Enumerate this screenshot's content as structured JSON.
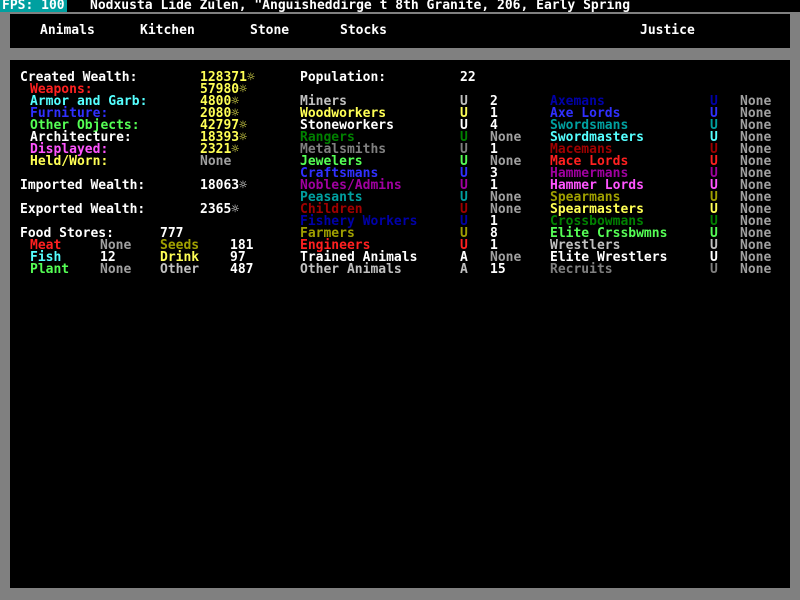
{
  "topbar": {
    "fps": "FPS: 100",
    "title": "Nodxusta Lide Zulen, \"Anguisheddirge t 8th Granite, 206, Early Spring"
  },
  "tabs": [
    "Animals",
    "Kitchen",
    "Stone",
    "Stocks",
    "Justice"
  ],
  "wealth": {
    "created": {
      "label": "Created Wealth:",
      "value": "128371☼"
    },
    "items": [
      {
        "label": "Weapons:",
        "value": "57980☼",
        "color": "#ff2020"
      },
      {
        "label": "Armor and Garb:",
        "value": "4800☼",
        "color": "#55ffff"
      },
      {
        "label": "Furniture:",
        "value": "2080☼",
        "color": "#3030ff"
      },
      {
        "label": "Other Objects:",
        "value": "42797☼",
        "color": "#55ff55"
      },
      {
        "label": "Architecture:",
        "value": "18393☼",
        "color": "#ffffff"
      },
      {
        "label": "Displayed:",
        "value": "2321☼",
        "color": "#ff55ff"
      },
      {
        "label": "Held/Worn:",
        "value": "None",
        "color": "#ffff55"
      }
    ],
    "imported": {
      "label": "Imported Wealth:",
      "value": "18063☼"
    },
    "exported": {
      "label": "Exported Wealth:",
      "value": "2365☼"
    }
  },
  "food": {
    "label": "Food Stores:",
    "value": "777",
    "meat": {
      "label": "Meat",
      "value": "None"
    },
    "seeds": {
      "label": "Seeds",
      "value": "181"
    },
    "fish": {
      "label": "Fish",
      "value": "12"
    },
    "drink": {
      "label": "Drink",
      "value": "97"
    },
    "plant": {
      "label": "Plant",
      "value": "None"
    },
    "other": {
      "label": "Other",
      "value": "487"
    }
  },
  "population": {
    "label": "Population:",
    "value": "22",
    "col1": [
      {
        "label": "Miners",
        "flag": "U",
        "value": "2",
        "color": "#c0c0c0"
      },
      {
        "label": "Woodworkers",
        "flag": "U",
        "value": "1",
        "color": "#ffff55"
      },
      {
        "label": "Stoneworkers",
        "flag": "U",
        "value": "4",
        "color": "#ffffff"
      },
      {
        "label": "Rangers",
        "flag": "U",
        "value": "None",
        "color": "#008000"
      },
      {
        "label": "Metalsmiths",
        "flag": "U",
        "value": "1",
        "color": "#808080"
      },
      {
        "label": "Jewelers",
        "flag": "U",
        "value": "None",
        "color": "#55ff55"
      },
      {
        "label": "Craftsmans",
        "flag": "U",
        "value": "3",
        "color": "#3030ff"
      },
      {
        "label": "Nobles/Admins",
        "flag": "U",
        "value": "1",
        "color": "#a000a0"
      },
      {
        "label": "Peasants",
        "flag": "U",
        "value": "None",
        "color": "#00a0a0"
      },
      {
        "label": "Children",
        "flag": "U",
        "value": "None",
        "color": "#a00000"
      },
      {
        "label": "Fishery Workers",
        "flag": "U",
        "value": "1",
        "color": "#0000a8"
      },
      {
        "label": "Farmers",
        "flag": "U",
        "value": "8",
        "color": "#a0a000"
      },
      {
        "label": "Engineers",
        "flag": "U",
        "value": "1",
        "color": "#ff2020"
      },
      {
        "label": "Trained Animals",
        "flag": "A",
        "value": "None",
        "color": "#ffffff"
      },
      {
        "label": "Other Animals",
        "flag": "A",
        "value": "15",
        "color": "#c0c0c0"
      }
    ],
    "col2": [
      {
        "label": "Axemans",
        "flag": "U",
        "value": "None",
        "color": "#0000a8"
      },
      {
        "label": "Axe Lords",
        "flag": "U",
        "value": "None",
        "color": "#3030ff"
      },
      {
        "label": "Swordsmans",
        "flag": "U",
        "value": "None",
        "color": "#00a0a0"
      },
      {
        "label": "Swordmasters",
        "flag": "U",
        "value": "None",
        "color": "#55ffff"
      },
      {
        "label": "Macemans",
        "flag": "U",
        "value": "None",
        "color": "#a00000"
      },
      {
        "label": "Mace Lords",
        "flag": "U",
        "value": "None",
        "color": "#ff2020"
      },
      {
        "label": "Hammermans",
        "flag": "U",
        "value": "None",
        "color": "#a000a0"
      },
      {
        "label": "Hammer Lords",
        "flag": "U",
        "value": "None",
        "color": "#ff55ff"
      },
      {
        "label": "Spearmans",
        "flag": "U",
        "value": "None",
        "color": "#a0a000"
      },
      {
        "label": "Spearmasters",
        "flag": "U",
        "value": "None",
        "color": "#ffff55"
      },
      {
        "label": "Crossbowmans",
        "flag": "U",
        "value": "None",
        "color": "#008000"
      },
      {
        "label": "Elite Crssbwmns",
        "flag": "U",
        "value": "None",
        "color": "#55ff55"
      },
      {
        "label": "Wrestlers",
        "flag": "U",
        "value": "None",
        "color": "#c0c0c0"
      },
      {
        "label": "Elite Wrestlers",
        "flag": "U",
        "value": "None",
        "color": "#ffffff"
      },
      {
        "label": "Recruits",
        "flag": "U",
        "value": "None",
        "color": "#808080"
      }
    ]
  }
}
